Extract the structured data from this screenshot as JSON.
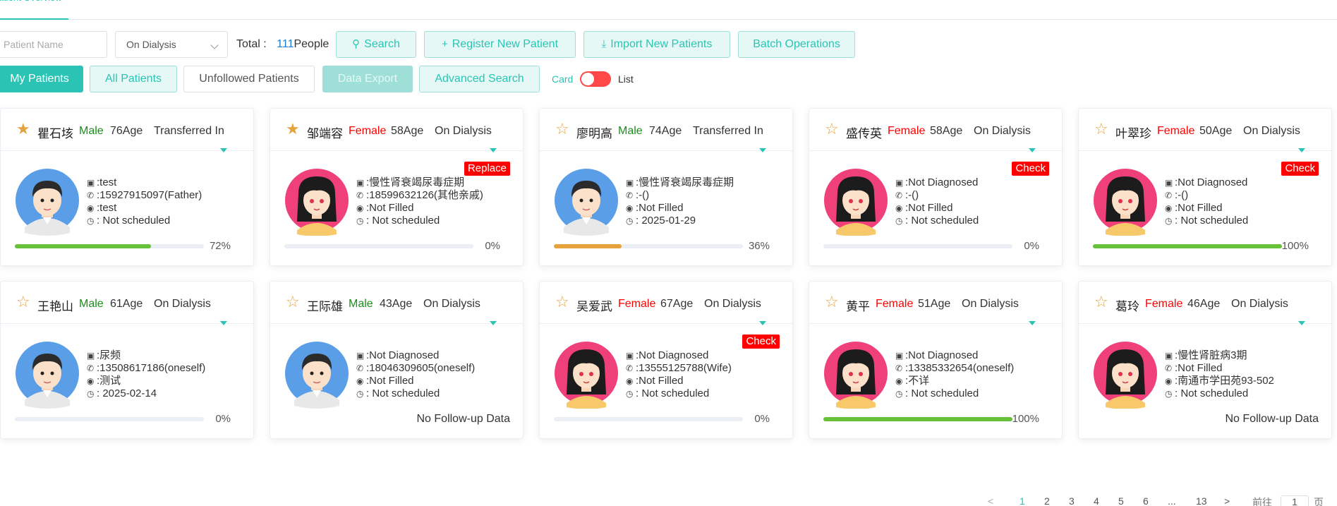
{
  "tabs": {
    "active": "atient Overview"
  },
  "filters": {
    "name_placeholder": "Patient Name",
    "status_value": "On Dialysis",
    "total_label": "Total :",
    "total_count": "111",
    "total_unit": "People"
  },
  "toolbar": {
    "search": "Search",
    "register": "Register New Patient",
    "import": "Import New Patients",
    "batch": "Batch Operations",
    "my_patients": "My Patients",
    "all_patients": "All Patients",
    "unfollowed": "Unfollowed Patients",
    "export": "Data Export",
    "advanced": "Advanced Search",
    "view_card": "Card",
    "view_list": "List"
  },
  "colors": {
    "accent": "#2bc4b4",
    "male": "#1a8f1a",
    "female": "#ff0000",
    "badge": "#ff0000",
    "progress_green": "#67c23a",
    "progress_orange": "#e6a23c",
    "toggle": "#ff4949"
  },
  "patients": [
    {
      "name": "瞿石垓",
      "gender": "Male",
      "age": "76Age",
      "status": "Transferred In",
      "starred": true,
      "diag": ":test",
      "phone": ":15927915097(Father)",
      "addr": ":test",
      "schedule": ": Not scheduled",
      "progress": "72%",
      "progress_value": 72,
      "progress_color": "green",
      "badge": ""
    },
    {
      "name": "邹端容",
      "gender": "Female",
      "age": "58Age",
      "status": "On Dialysis",
      "starred": true,
      "diag": ":慢性肾衰竭尿毒症期",
      "phone": ":18599632126(其他亲戚)",
      "addr": ":Not Filled",
      "schedule": ": Not scheduled",
      "progress": "0%",
      "progress_value": 0,
      "progress_color": "green",
      "badge": "Replace"
    },
    {
      "name": "廖明高",
      "gender": "Male",
      "age": "74Age",
      "status": "Transferred In",
      "starred": false,
      "diag": ":慢性肾衰竭尿毒症期",
      "phone": ":-()",
      "addr": ":Not Filled",
      "schedule": ": 2025-01-29",
      "progress": "36%",
      "progress_value": 36,
      "progress_color": "orange",
      "badge": ""
    },
    {
      "name": "盛传英",
      "gender": "Female",
      "age": "58Age",
      "status": "On Dialysis",
      "starred": false,
      "diag": ":Not Diagnosed",
      "phone": ":-()",
      "addr": ":Not Filled",
      "schedule": ": Not scheduled",
      "progress": "0%",
      "progress_value": 0,
      "progress_color": "green",
      "badge": "Check"
    },
    {
      "name": "叶翠珍",
      "gender": "Female",
      "age": "50Age",
      "status": "On Dialysis",
      "starred": false,
      "diag": ":Not Diagnosed",
      "phone": ":-()",
      "addr": ":Not Filled",
      "schedule": ": Not scheduled",
      "progress": "100%",
      "progress_value": 100,
      "progress_color": "green",
      "badge": "Check"
    },
    {
      "name": "王艳山",
      "gender": "Male",
      "age": "61Age",
      "status": "On Dialysis",
      "starred": false,
      "diag": ":尿频",
      "phone": ":13508617186(oneself)",
      "addr": ":测试",
      "schedule": ": 2025-02-14",
      "progress": "0%",
      "progress_value": 0,
      "progress_color": "green",
      "badge": ""
    },
    {
      "name": "王际雄",
      "gender": "Male",
      "age": "43Age",
      "status": "On Dialysis",
      "starred": false,
      "diag": ":Not Diagnosed",
      "phone": ":18046309605(oneself)",
      "addr": ":Not Filled",
      "schedule": ": Not scheduled",
      "progress": "",
      "progress_value": null,
      "progress_color": "",
      "badge": "",
      "nofollow": "No Follow-up Data"
    },
    {
      "name": "吴爱武",
      "gender": "Female",
      "age": "67Age",
      "status": "On Dialysis",
      "starred": false,
      "diag": ":Not Diagnosed",
      "phone": ":13555125788(Wife)",
      "addr": ":Not Filled",
      "schedule": ": Not scheduled",
      "progress": "0%",
      "progress_value": 0,
      "progress_color": "green",
      "badge": "Check"
    },
    {
      "name": "黄平",
      "gender": "Female",
      "age": "51Age",
      "status": "On Dialysis",
      "starred": false,
      "diag": ":Not Diagnosed",
      "phone": ":13385332654(oneself)",
      "addr": ":不详",
      "schedule": ": Not scheduled",
      "progress": "100%",
      "progress_value": 100,
      "progress_color": "green",
      "badge": ""
    },
    {
      "name": "葛玲",
      "gender": "Female",
      "age": "46Age",
      "status": "On Dialysis",
      "starred": false,
      "diag": ":慢性肾脏病3期",
      "phone": ":Not Filled",
      "addr": ":南通市学田苑93-502",
      "schedule": ": Not scheduled",
      "progress": "",
      "progress_value": null,
      "progress_color": "",
      "badge": "",
      "nofollow": "No Follow-up Data"
    }
  ],
  "pager": {
    "prev": "<",
    "pages": [
      "1",
      "2",
      "3",
      "4",
      "5",
      "6",
      "...",
      "13"
    ],
    "next": ">",
    "goto_label": "前往",
    "goto_value": "1",
    "page_unit": "页"
  }
}
